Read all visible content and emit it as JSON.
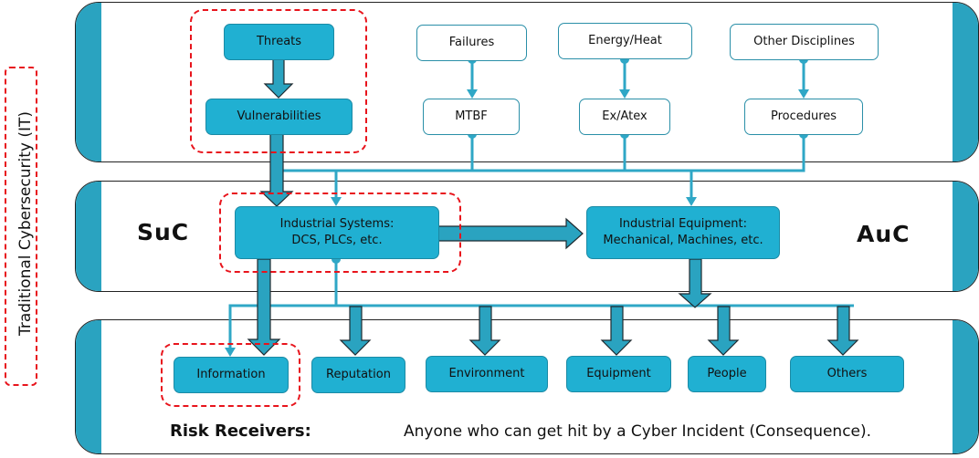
{
  "side_label": "Traditional Cybersecurity (IT)",
  "top_panel": {
    "threats": "Threats",
    "vulnerabilities": "Vulnerabilities",
    "columns": [
      {
        "source": "Failures",
        "target": "MTBF"
      },
      {
        "source": "Energy/Heat",
        "target": "Ex/Atex"
      },
      {
        "source": "Other Disciplines",
        "target": "Procedures"
      }
    ]
  },
  "middle_panel": {
    "left_label": "SuC",
    "right_label": "AuC",
    "industrial_systems": {
      "line1": "Industrial Systems:",
      "line2": "DCS, PLCs, etc."
    },
    "industrial_equipment": {
      "line1": "Industrial Equipment:",
      "line2": "Mechanical, Machines, etc."
    }
  },
  "bottom_panel": {
    "receivers": [
      "Information",
      "Reputation",
      "Environment",
      "Equipment",
      "People",
      "Others"
    ],
    "risk_label": "Risk Receivers:",
    "consequence_text": "Anyone who can get hit by a Cyber Incident (Consequence)."
  },
  "colors": {
    "accent": "#20b0d2",
    "accent_dark": "#2aa3c0",
    "highlight_dash": "#e8141c"
  }
}
